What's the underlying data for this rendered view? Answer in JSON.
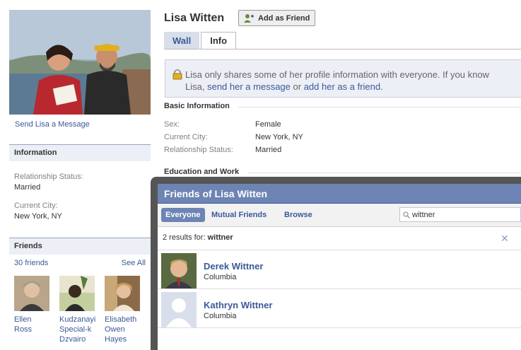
{
  "profile": {
    "name": "Lisa Witten",
    "add_friend_label": "Add as Friend",
    "send_message_label": "Send Lisa a Message"
  },
  "tabs": [
    {
      "label": "Wall",
      "active": false
    },
    {
      "label": "Info",
      "active": true
    }
  ],
  "notice": {
    "line1": "Lisa only shares some of her profile information with everyone. If you know",
    "line2_prefix": "Lisa,",
    "send_link": "send her a message",
    "middle": "or",
    "add_link": "add her as a friend",
    "suffix": "."
  },
  "basic_info": {
    "title": "Basic Information",
    "rows": [
      {
        "label": "Sex:",
        "value": "Female"
      },
      {
        "label": "Current City:",
        "value": "New York, NY"
      },
      {
        "label": "Relationship Status:",
        "value": "Married"
      }
    ]
  },
  "education": {
    "title": "Education and Work"
  },
  "sidebar": {
    "info_title": "Information",
    "info_items": [
      {
        "label": "Relationship Status:",
        "value": "Married"
      },
      {
        "label": "Current City:",
        "value": "New York, NY"
      }
    ],
    "friends_title": "Friends",
    "friends_count": "30 friends",
    "see_all": "See All",
    "friends": [
      {
        "name": "Ellen Ross"
      },
      {
        "name": "Kudzanayi Special-k Dzvairo"
      },
      {
        "name": "Elisabeth Owen Hayes"
      }
    ]
  },
  "dialog": {
    "title": "Friends of Lisa Witten",
    "tabs": [
      {
        "label": "Everyone",
        "active": true
      },
      {
        "label": "Mutual Friends",
        "active": false
      },
      {
        "label": "Browse",
        "active": false
      }
    ],
    "search_value": "wittner",
    "results_prefix": "2 results for:",
    "results_query": "wittner",
    "clear_icon": "close-icon",
    "results": [
      {
        "name": "Derek Wittner",
        "network": "Columbia"
      },
      {
        "name": "Kathryn Wittner",
        "network": "Columbia"
      }
    ]
  },
  "colors": {
    "brand": "#3b5998",
    "dialog_header": "#6d84b4",
    "sidebar_bg": "#eceff5"
  }
}
